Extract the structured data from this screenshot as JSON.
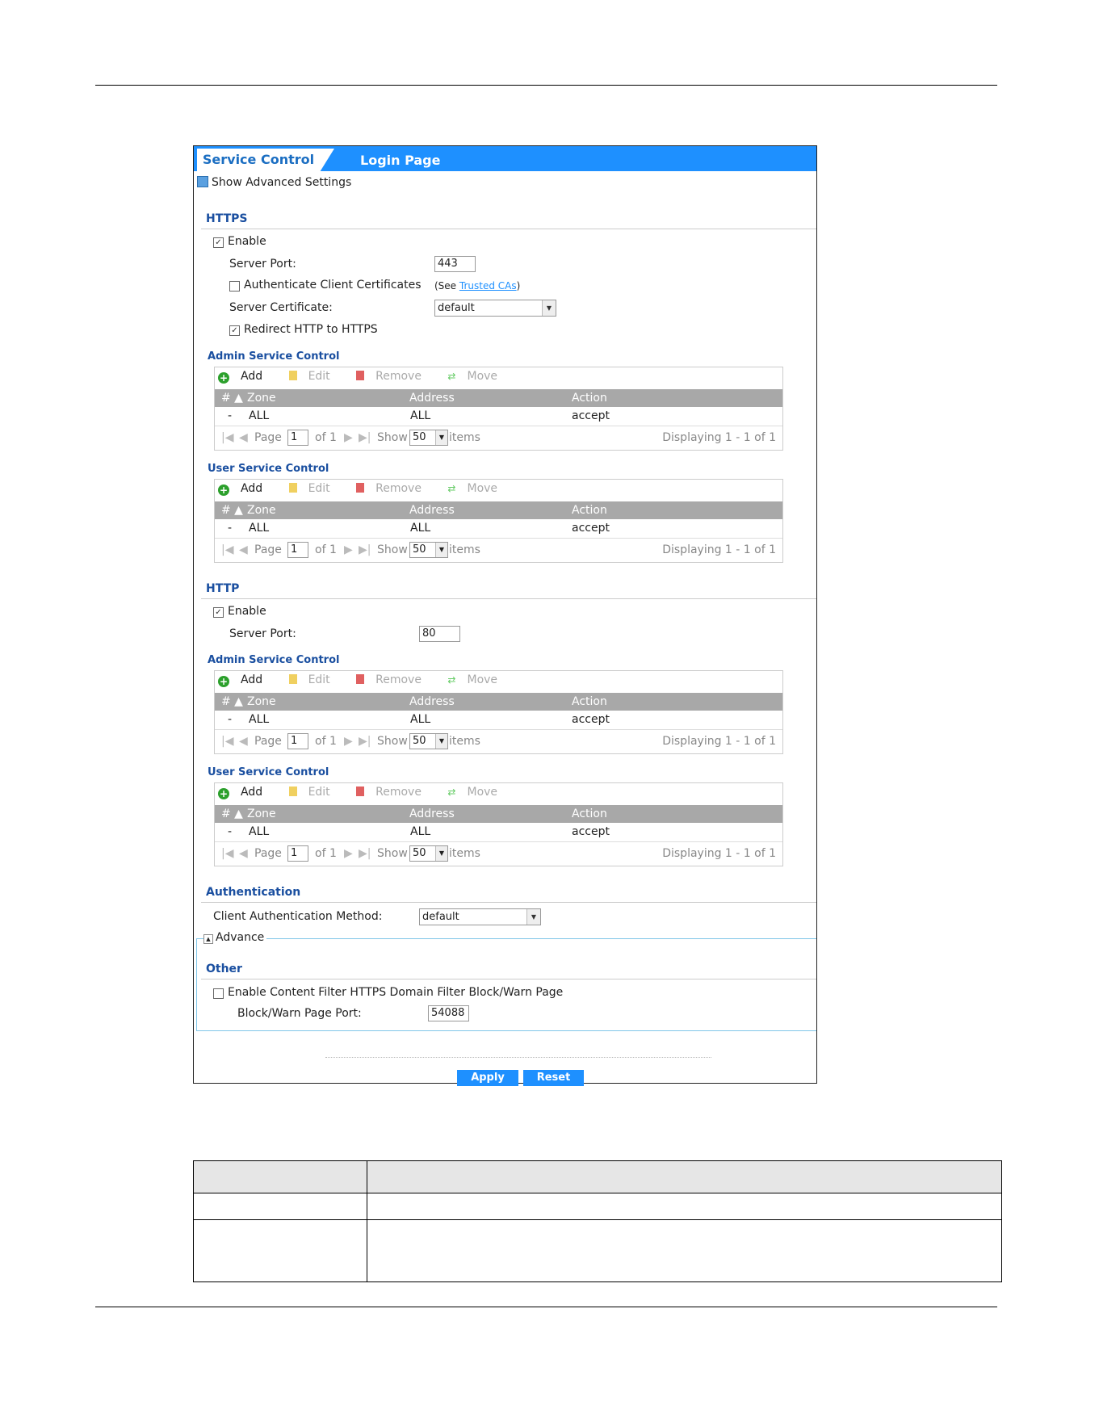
{
  "tabs": {
    "active": "Service Control",
    "other": "Login Page"
  },
  "show_advanced": "Show Advanced Settings",
  "https": {
    "title": "HTTPS",
    "enable_label": "Enable",
    "server_port_label": "Server Port:",
    "server_port_value": "443",
    "auth_client_certs_label": "Authenticate Client Certificates",
    "see_prefix": "(See ",
    "trusted_cas_link": "Trusted CAs",
    "see_suffix": ")",
    "server_cert_label": "Server Certificate:",
    "server_cert_value": "default",
    "redirect_label": "Redirect HTTP to HTTPS"
  },
  "http": {
    "title": "HTTP",
    "enable_label": "Enable",
    "server_port_label": "Server Port:",
    "server_port_value": "80"
  },
  "control_titles": {
    "admin": "Admin Service Control",
    "user": "User Service Control"
  },
  "toolbar": {
    "add": "Add",
    "edit": "Edit",
    "remove": "Remove",
    "move": "Move"
  },
  "table_headers": {
    "num": "#",
    "zone": "Zone",
    "address": "Address",
    "action": "Action"
  },
  "table_row": {
    "num": "-",
    "zone": "ALL",
    "address": "ALL",
    "action": "accept"
  },
  "pager": {
    "page_label": "Page",
    "page_value": "1",
    "of": "of 1",
    "show_label": "Show",
    "show_value": "50",
    "items_label": "items",
    "displaying": "Displaying 1 - 1 of 1"
  },
  "authentication": {
    "title": "Authentication",
    "method_label": "Client Authentication Method:",
    "method_value": "default",
    "advance_label": "Advance"
  },
  "other": {
    "title": "Other",
    "content_filter_label": "Enable Content Filter HTTPS Domain Filter Block/Warn Page",
    "block_port_label": "Block/Warn Page Port:",
    "block_port_value": "54088"
  },
  "buttons": {
    "apply": "Apply",
    "reset": "Reset"
  }
}
